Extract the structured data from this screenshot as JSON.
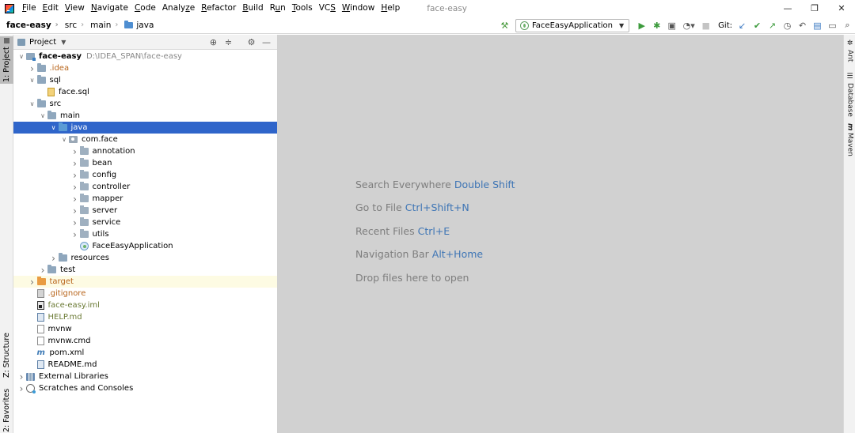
{
  "window": {
    "title": "face-easy",
    "controls": [
      "—",
      "❐",
      "✕"
    ]
  },
  "menu": [
    {
      "label": "File",
      "mnemonic": "F"
    },
    {
      "label": "Edit",
      "mnemonic": "E"
    },
    {
      "label": "View",
      "mnemonic": "V"
    },
    {
      "label": "Navigate",
      "mnemonic": "N"
    },
    {
      "label": "Code",
      "mnemonic": "C"
    },
    {
      "label": "Analyze",
      "mnemonic": "z"
    },
    {
      "label": "Refactor",
      "mnemonic": "R"
    },
    {
      "label": "Build",
      "mnemonic": "B"
    },
    {
      "label": "Run",
      "mnemonic": "u"
    },
    {
      "label": "Tools",
      "mnemonic": "T"
    },
    {
      "label": "VCS",
      "mnemonic": "S"
    },
    {
      "label": "Window",
      "mnemonic": "W"
    },
    {
      "label": "Help",
      "mnemonic": "H"
    }
  ],
  "breadcrumb": [
    "face-easy",
    "src",
    "main",
    "java"
  ],
  "toolbar": {
    "run_config": "FaceEasyApplication",
    "git_label": "Git:"
  },
  "left_strip": {
    "project_tab": "1: Project",
    "structure_tab": "Z: Structure",
    "favorites_tab": "2: Favorites"
  },
  "project_panel": {
    "title": "Project",
    "tree": [
      {
        "label": "face-easy",
        "path": "D:\\IDEA_SPAN\\face-easy",
        "depth": 0,
        "arrow": "open",
        "icon": "module",
        "style": "bold"
      },
      {
        "label": ".idea",
        "depth": 1,
        "arrow": "closed",
        "icon": "folder",
        "style": "orange"
      },
      {
        "label": "sql",
        "depth": 1,
        "arrow": "open",
        "icon": "folder",
        "style": ""
      },
      {
        "label": "face.sql",
        "depth": 2,
        "arrow": "none",
        "icon": "sql",
        "style": ""
      },
      {
        "label": "src",
        "depth": 1,
        "arrow": "open",
        "icon": "folder",
        "style": ""
      },
      {
        "label": "main",
        "depth": 2,
        "arrow": "open",
        "icon": "folder",
        "style": ""
      },
      {
        "label": "java",
        "depth": 3,
        "arrow": "open",
        "icon": "src",
        "style": "",
        "selected": true
      },
      {
        "label": "com.face",
        "depth": 4,
        "arrow": "open",
        "icon": "package",
        "style": ""
      },
      {
        "label": "annotation",
        "depth": 5,
        "arrow": "closed",
        "icon": "pkgfolder",
        "style": ""
      },
      {
        "label": "bean",
        "depth": 5,
        "arrow": "closed",
        "icon": "pkgfolder",
        "style": ""
      },
      {
        "label": "config",
        "depth": 5,
        "arrow": "closed",
        "icon": "pkgfolder",
        "style": ""
      },
      {
        "label": "controller",
        "depth": 5,
        "arrow": "closed",
        "icon": "pkgfolder",
        "style": ""
      },
      {
        "label": "mapper",
        "depth": 5,
        "arrow": "closed",
        "icon": "pkgfolder",
        "style": ""
      },
      {
        "label": "server",
        "depth": 5,
        "arrow": "closed",
        "icon": "pkgfolder",
        "style": ""
      },
      {
        "label": "service",
        "depth": 5,
        "arrow": "closed",
        "icon": "pkgfolder",
        "style": ""
      },
      {
        "label": "utils",
        "depth": 5,
        "arrow": "closed",
        "icon": "pkgfolder",
        "style": ""
      },
      {
        "label": "FaceEasyApplication",
        "depth": 5,
        "arrow": "none",
        "icon": "spring",
        "style": ""
      },
      {
        "label": "resources",
        "depth": 3,
        "arrow": "closed",
        "icon": "folder",
        "style": ""
      },
      {
        "label": "test",
        "depth": 2,
        "arrow": "closed",
        "icon": "folder",
        "style": ""
      },
      {
        "label": "target",
        "depth": 1,
        "arrow": "closed",
        "icon": "target",
        "style": "orange",
        "excluded": true
      },
      {
        "label": ".gitignore",
        "depth": 1,
        "arrow": "none",
        "icon": "git",
        "style": "orange"
      },
      {
        "label": "face-easy.iml",
        "depth": 1,
        "arrow": "none",
        "icon": "iml",
        "style": "added"
      },
      {
        "label": "HELP.md",
        "depth": 1,
        "arrow": "none",
        "icon": "md",
        "style": "added"
      },
      {
        "label": "mvnw",
        "depth": 1,
        "arrow": "none",
        "icon": "file",
        "style": ""
      },
      {
        "label": "mvnw.cmd",
        "depth": 1,
        "arrow": "none",
        "icon": "file",
        "style": ""
      },
      {
        "label": "pom.xml",
        "depth": 1,
        "arrow": "none",
        "icon": "xml",
        "style": ""
      },
      {
        "label": "README.md",
        "depth": 1,
        "arrow": "none",
        "icon": "md",
        "style": ""
      },
      {
        "label": "External Libraries",
        "depth": 0,
        "arrow": "closed",
        "icon": "lib",
        "style": ""
      },
      {
        "label": "Scratches and Consoles",
        "depth": 0,
        "arrow": "closed",
        "icon": "scratch",
        "style": ""
      }
    ]
  },
  "editor_hints": [
    {
      "text": "Search Everywhere",
      "key": "Double Shift"
    },
    {
      "text": "Go to File",
      "key": "Ctrl+Shift+N"
    },
    {
      "text": "Recent Files",
      "key": "Ctrl+E"
    },
    {
      "text": "Navigation Bar",
      "key": "Alt+Home"
    },
    {
      "text": "Drop files here to open",
      "key": ""
    }
  ],
  "right_strip": [
    "Ant",
    "Database",
    "Maven"
  ],
  "colors": {
    "selection": "#2f65ca",
    "editor_bg": "#d1d1d1",
    "hint_key": "#3e75b5",
    "excluded_orange": "#b8651c"
  }
}
